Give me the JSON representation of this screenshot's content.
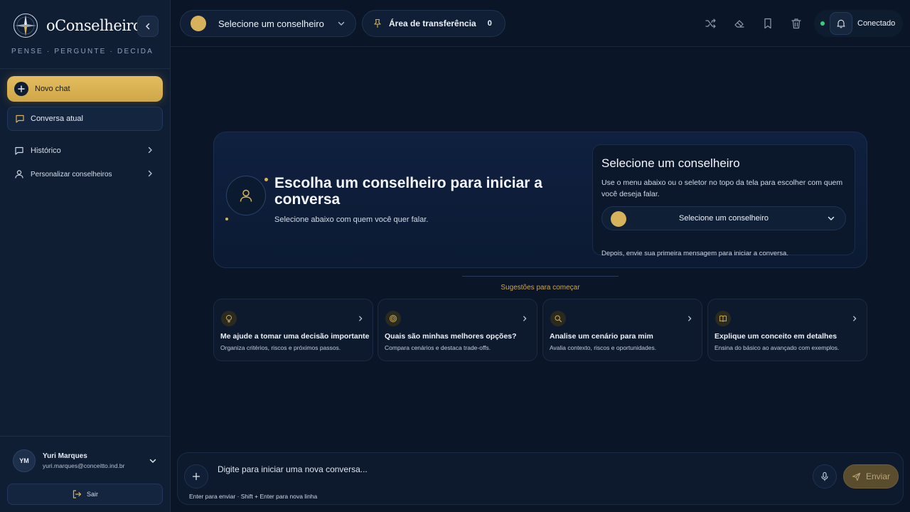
{
  "colors": {
    "accent_gold": "#d6b25a",
    "background": "#0a1628",
    "status_online": "#33d17a"
  },
  "brand": {
    "name": "oConselheiro",
    "tagline": "PENSE · PERGUNTE · DECIDA",
    "logo_icon": "compass-icon"
  },
  "sidebar": {
    "new_chat": "Novo chat",
    "current_conversation": "Conversa atual",
    "items": [
      {
        "label": "Histórico",
        "icon": "chat-icon"
      },
      {
        "label": "Personalizar conselheiros",
        "icon": "user-icon"
      }
    ],
    "user": {
      "initials": "YM",
      "name": "Yuri Marques",
      "email": "yuri.marques@conceitto.ind.br"
    },
    "logout": "Sair"
  },
  "topbar": {
    "advisor_select": "Selecione um conselheiro",
    "clipboard_label": "Área de transferência",
    "clipboard_count": "0",
    "status": "Conectado"
  },
  "hero": {
    "title": "Escolha um conselheiro para iniciar a conversa",
    "subtitle": "Selecione abaixo com quem você quer falar.",
    "panel": {
      "title": "Selecione um conselheiro",
      "description": "Use o menu abaixo ou o seletor no topo da tela para escolher com quem você deseja falar.",
      "select_label": "Selecione um conselheiro",
      "note": "Depois, envie sua primeira mensagem para iniciar a conversa."
    }
  },
  "suggestions": {
    "heading": "Sugestões para começar",
    "cards": [
      {
        "title": "Me ajude a tomar uma decisão importante",
        "description": "Organiza critérios, riscos e próximos passos.",
        "icon": "lightbulb-icon"
      },
      {
        "title": "Quais são minhas melhores opções?",
        "description": "Compara cenários e destaca trade-offs.",
        "icon": "target-icon"
      },
      {
        "title": "Analise um cenário para mim",
        "description": "Avalia contexto, riscos e oportunidades.",
        "icon": "magnifier-icon"
      },
      {
        "title": "Explique um conceito em detalhes",
        "description": "Ensina do básico ao avançado com exemplos.",
        "icon": "book-icon"
      }
    ]
  },
  "composer": {
    "placeholder": "Digite para iniciar uma nova conversa...",
    "send": "Enviar",
    "hint": "Enter para enviar · Shift + Enter para nova linha"
  }
}
